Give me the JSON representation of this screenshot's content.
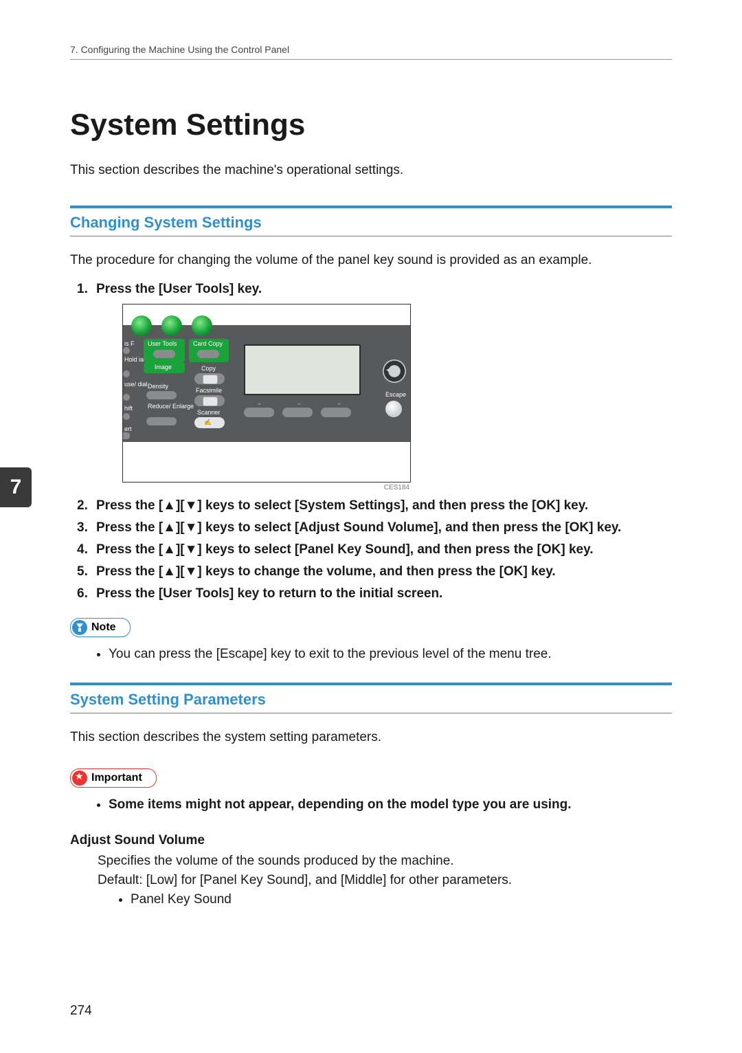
{
  "running_head": "7. Configuring the Machine Using the Control Panel",
  "chapter_title": "System Settings",
  "lead": "This section describes the machine's operational settings.",
  "section1": {
    "title": "Changing System Settings",
    "intro": "The procedure for changing the volume of the panel key sound is provided as an example.",
    "steps": [
      "Press the [User Tools] key.",
      "Press the [▲][▼] keys to select [System Settings], and then press the [OK] key.",
      "Press the [▲][▼] keys to select [Adjust Sound Volume], and then press the [OK] key.",
      "Press the [▲][▼] keys to select [Panel Key Sound], and then press the [OK] key.",
      "Press the [▲][▼] keys to change the volume, and then press the [OK] key.",
      "Press the [User Tools] key to return to the initial screen."
    ],
    "note_label": "Note",
    "note_item": "You can press the [Escape] key to exit to the previous level of the menu tree."
  },
  "section2": {
    "title": "System Setting Parameters",
    "intro": "This section describes the system setting parameters.",
    "important_label": "Important",
    "important_item": "Some items might not appear, depending on the model type you are using.",
    "param_term": "Adjust Sound Volume",
    "param_desc": "Specifies the volume of the sounds produced by the machine.",
    "param_default": "Default: [Low] for [Panel Key Sound], and [Middle] for other parameters.",
    "param_sub": "Panel Key Sound"
  },
  "figure": {
    "caption": "CES184",
    "labels": {
      "user_tools": "User Tools",
      "card_copy": "Card Copy",
      "image": "Image",
      "copy": "Copy",
      "density": "Density",
      "facsimile": "Facsimile",
      "reduce": "Reduce/\nEnlarge",
      "scanner": "Scanner",
      "escape": "Escape",
      "hift": "hift",
      "ert": "ert",
      "dial": "use/\ndial",
      "hold": "Hold\nial"
    }
  },
  "sidebar_tab": "7",
  "page_number": "274"
}
